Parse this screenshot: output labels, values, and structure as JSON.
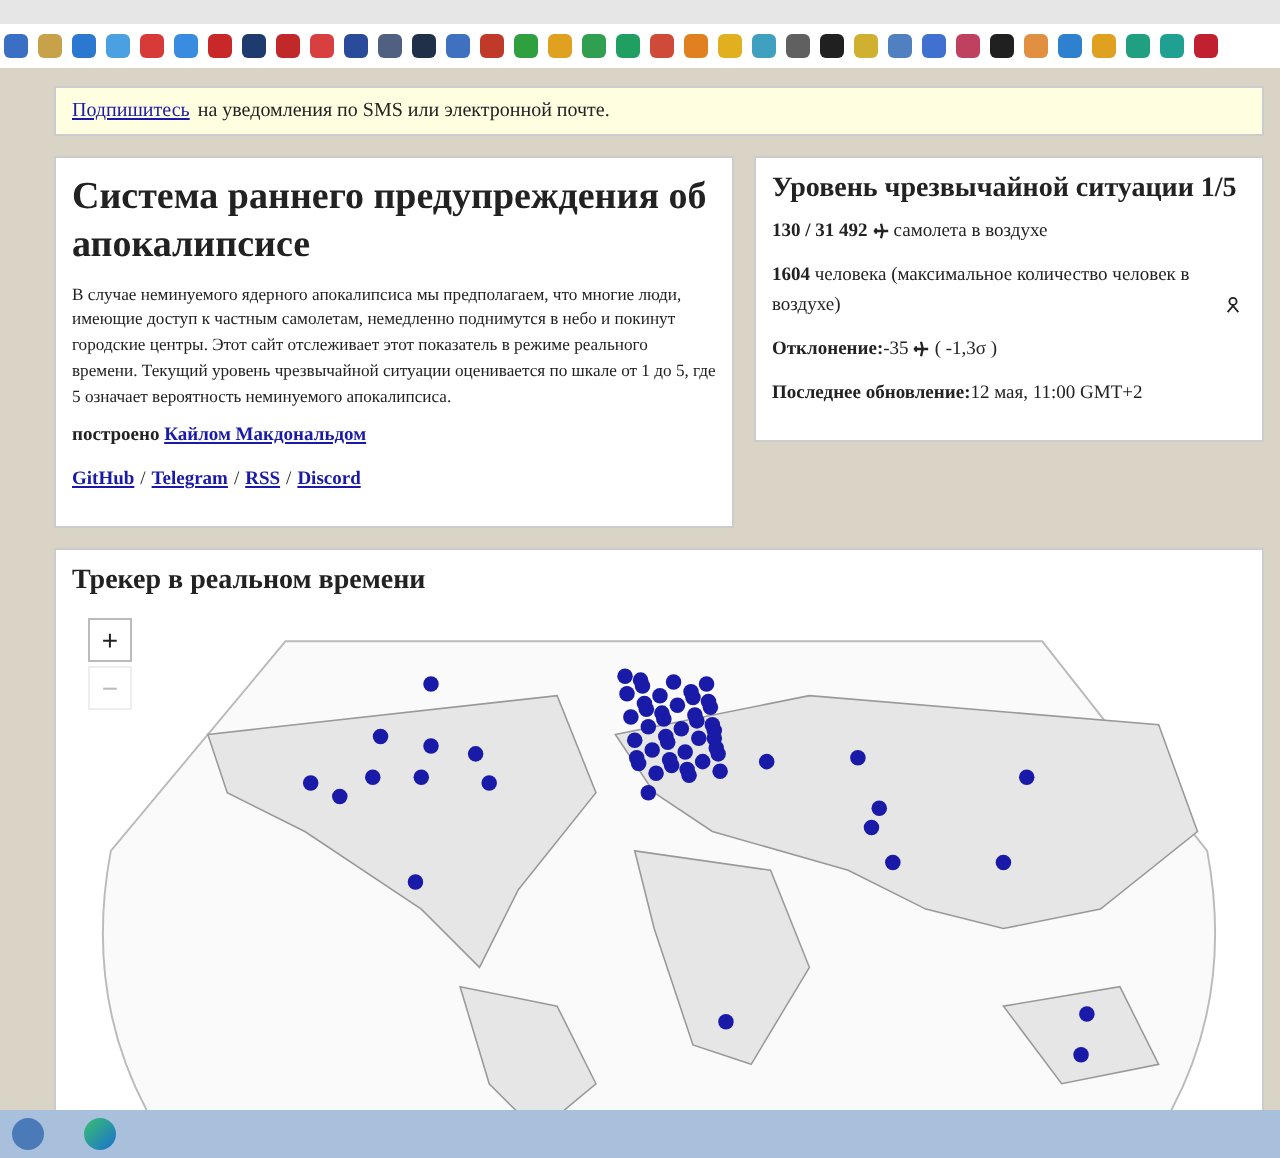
{
  "banner": {
    "link": "Подпишитесь",
    "text": "на уведомления по SMS или электронной почте."
  },
  "intro": {
    "title": "Система раннего предупреждения об апокалипсисе",
    "body": "В случае неминуемого ядерного апокалипсиса мы предполагаем, что многие люди, имеющие доступ к частным самолетам, немедленно поднимутся в небо и покинут городские центры. Этот сайт отслеживает этот показатель в режиме реального времени. Текущий уровень чрезвычайной ситуации оценивается по шкале от 1 до 5, где 5 означает вероятность неминуемого апокалипсиса.",
    "built_label": "построено",
    "built_link": "Кайлом Макдональдом",
    "links": [
      "GitHub",
      "Telegram",
      "RSS",
      "Discord"
    ],
    "link_separator": "/"
  },
  "status": {
    "title": "Уровень чрезвычайной ситуации 1/5",
    "planes_count": "130 / 31 492",
    "planes_text": "самолета в воздухе",
    "people_count": "1604",
    "people_text": "человека (максимальное количество человек в воздухе)",
    "deviation_label": "Отклонение:",
    "deviation_value": "-35",
    "deviation_sigma": "( -1,3σ )",
    "updated_label": "Последнее обновление:",
    "updated_value": "12 мая, 11:00 GMT+2"
  },
  "tracker": {
    "title": "Трекер в реальном времени",
    "zoom_in": "+",
    "zoom_out": "−"
  }
}
